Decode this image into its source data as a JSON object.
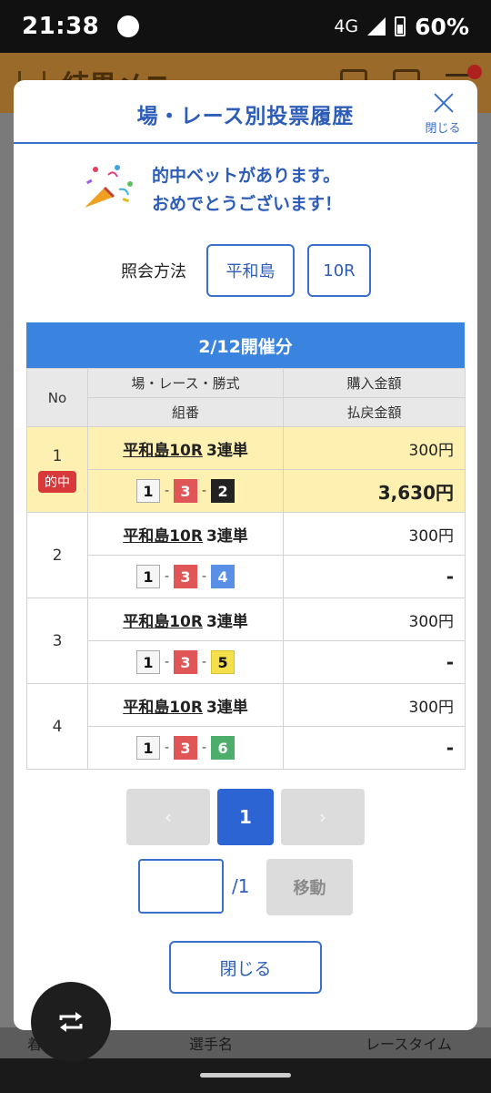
{
  "status_bar": {
    "time": "21:38",
    "network": "4G",
    "battery": "60%"
  },
  "background": {
    "header_title": "結果メニュー",
    "footer_columns": [
      "着",
      "枠",
      "選手名",
      "レースタイム"
    ]
  },
  "modal": {
    "title": "場・レース別投票履歴",
    "close_label": "閉じる",
    "congrats_line1": "的中ベットがあります。",
    "congrats_line2": "おめでとうございます！",
    "method_label": "照会方法",
    "method_venue": "平和島",
    "method_race": "10R",
    "date_label": "2/12開催分",
    "table": {
      "headers": {
        "no": "No",
        "race": "場・レース・勝式",
        "combo": "組番",
        "purchase": "購入金額",
        "payout": "払戻金額"
      },
      "hit_label": "的中",
      "rows": [
        {
          "no": "1",
          "venue_race": "平和島10R",
          "bet_type": "3連単",
          "combo": [
            "1",
            "3",
            "2"
          ],
          "purchase": "300円",
          "payout": "3,630円",
          "hit": true
        },
        {
          "no": "2",
          "venue_race": "平和島10R",
          "bet_type": "3連単",
          "combo": [
            "1",
            "3",
            "4"
          ],
          "purchase": "300円",
          "payout": "-",
          "hit": false
        },
        {
          "no": "3",
          "venue_race": "平和島10R",
          "bet_type": "3連単",
          "combo": [
            "1",
            "3",
            "5"
          ],
          "purchase": "300円",
          "payout": "-",
          "hit": false
        },
        {
          "no": "4",
          "venue_race": "平和島10R",
          "bet_type": "3連単",
          "combo": [
            "1",
            "3",
            "6"
          ],
          "purchase": "300円",
          "payout": "-",
          "hit": false
        }
      ],
      "combo_separator": "-"
    },
    "pager": {
      "prev": "‹",
      "current": "1",
      "next": "›"
    },
    "jump": {
      "value": "",
      "total": "/1",
      "button": "移動"
    },
    "close_button": "閉じる"
  },
  "colors": {
    "accent": "#2d5db8",
    "date_bar": "#3a84e0",
    "hit_row": "#fdf0b0",
    "hit_badge": "#d8383a"
  }
}
